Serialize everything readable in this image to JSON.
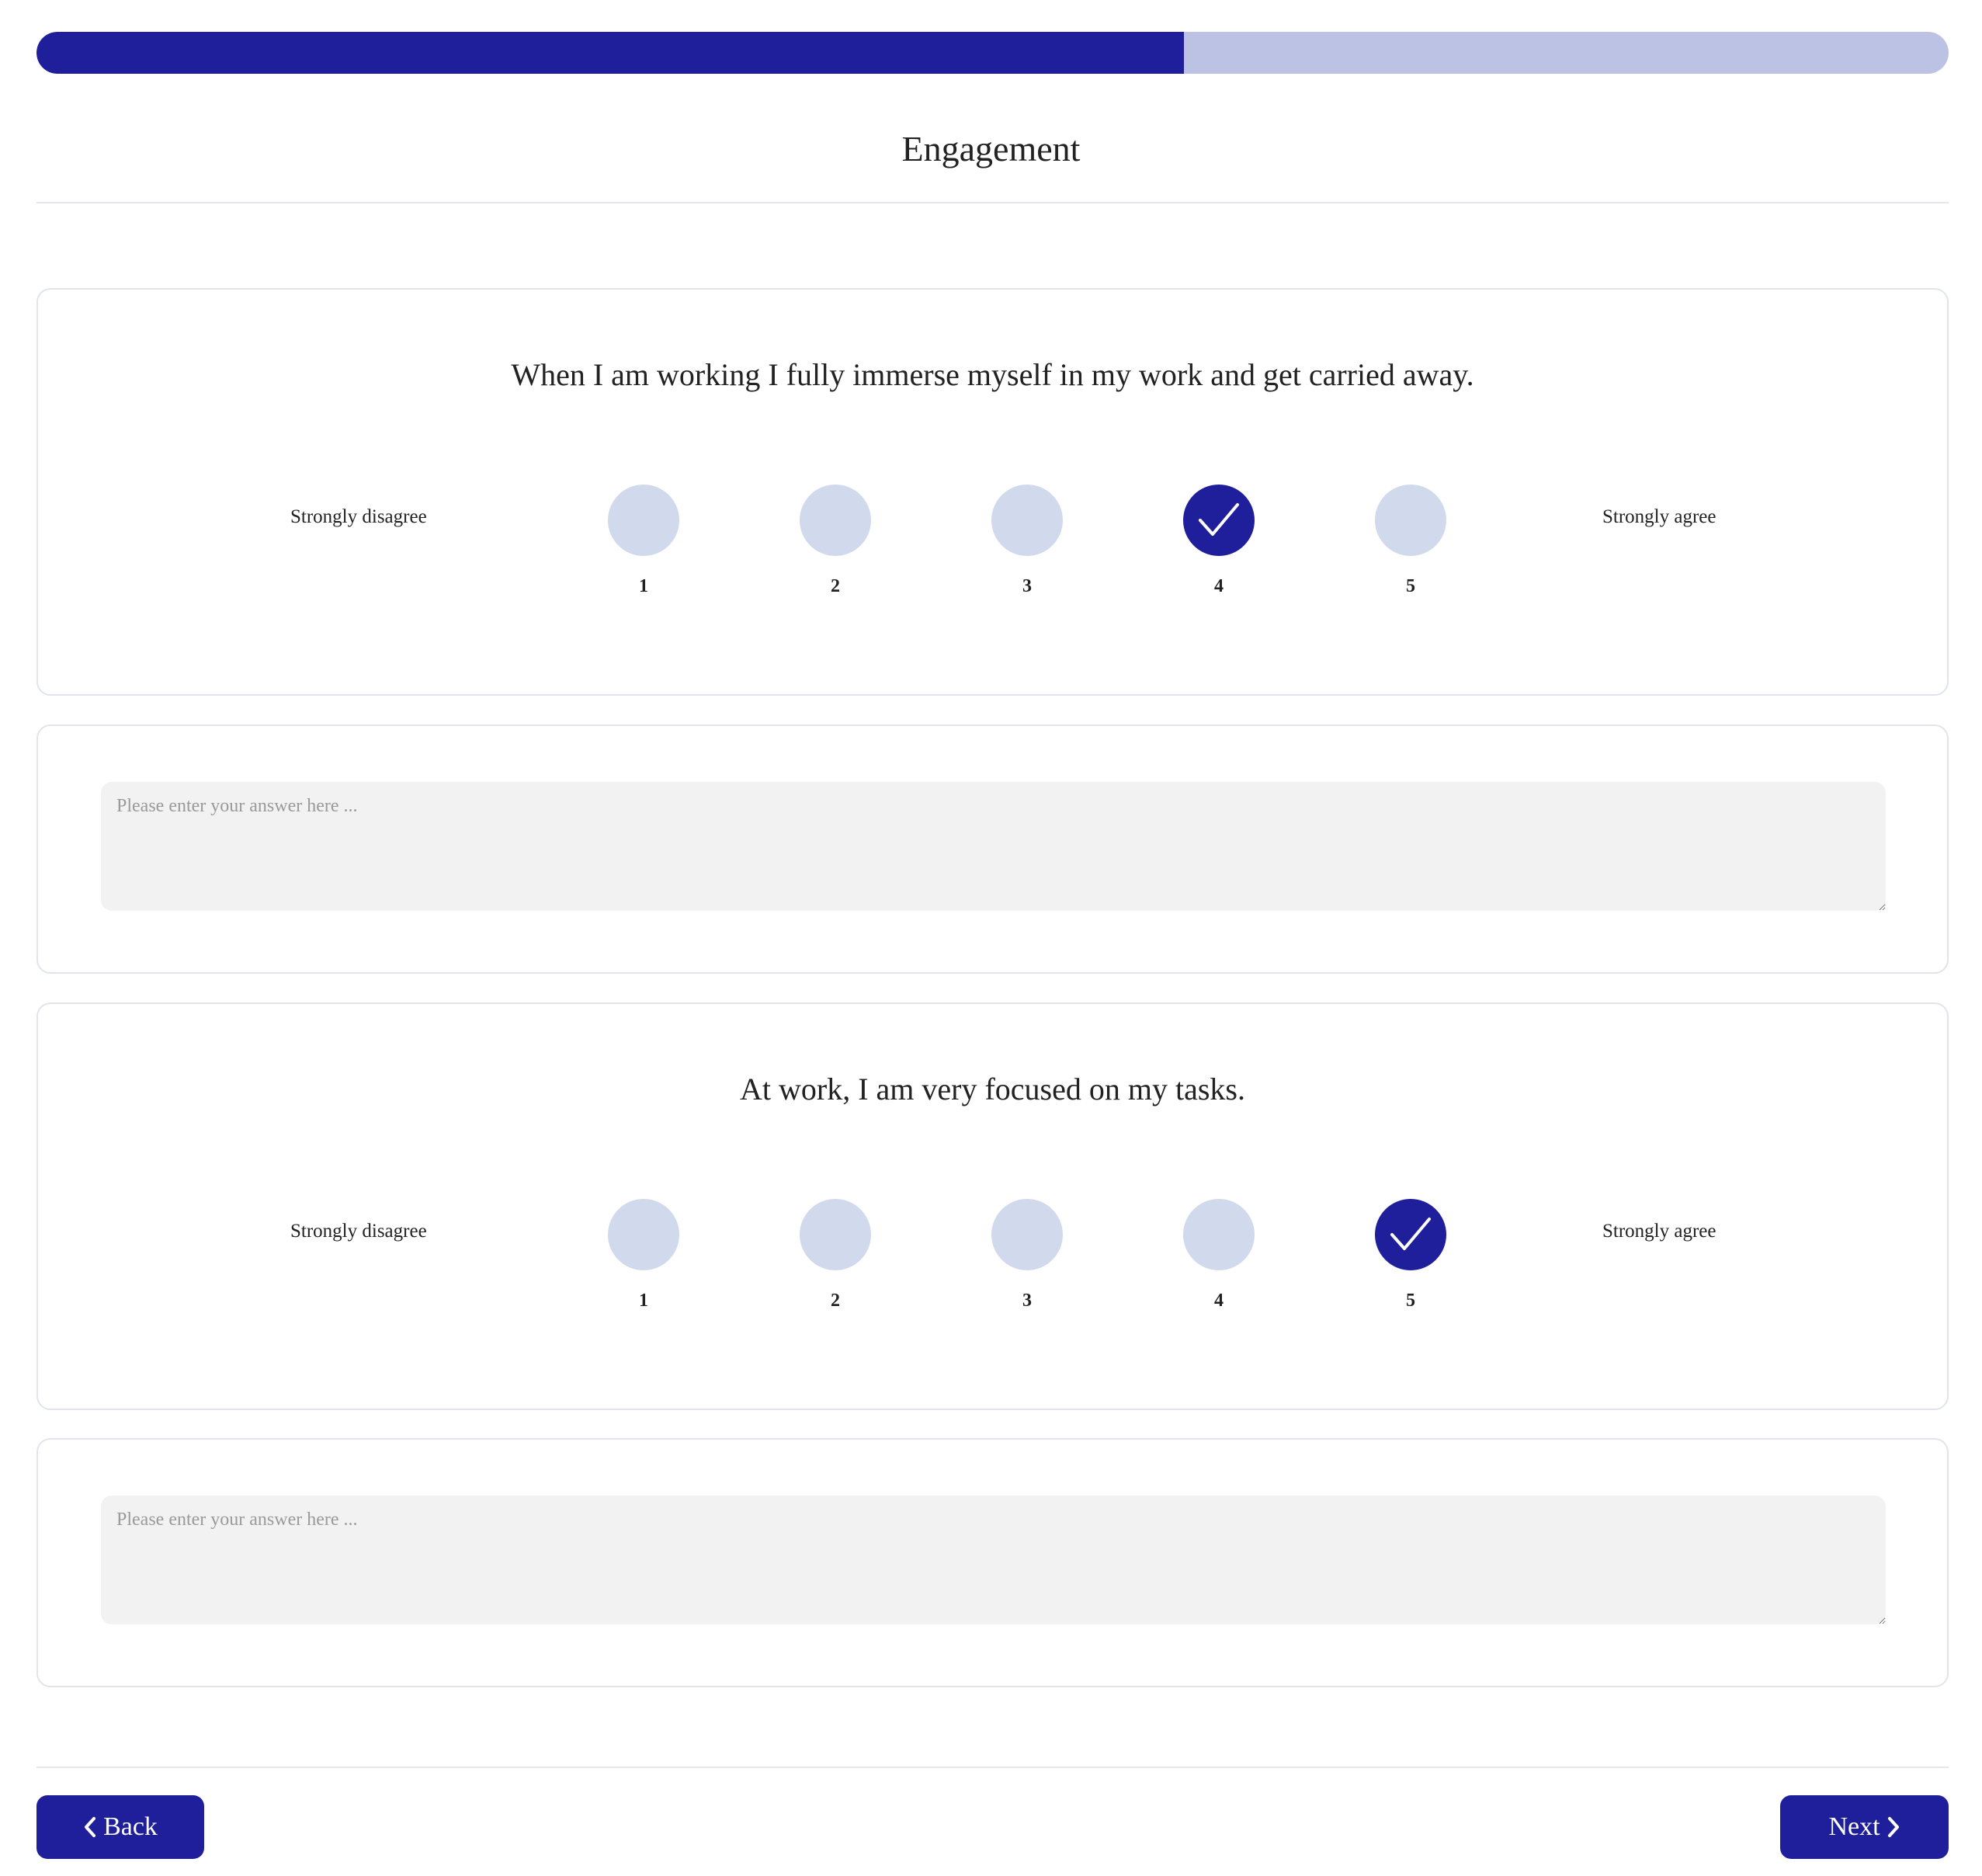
{
  "progress": {
    "fraction": 0.6,
    "color_fill": "#1f1f9c",
    "color_track": "#bcc2e3"
  },
  "page": {
    "title": "Engagement"
  },
  "questions": [
    {
      "text": "When I am working I fully immerse myself in my work and get carried away.",
      "scale_min_label": "Strongly disagree",
      "scale_max_label": "Strongly agree",
      "options": [
        "1",
        "2",
        "3",
        "4",
        "5"
      ],
      "selected": "4",
      "answer_placeholder": "Please enter your answer here ...",
      "answer_value": ""
    },
    {
      "text": "At work, I am very focused on my tasks.",
      "scale_min_label": "Strongly disagree",
      "scale_max_label": "Strongly agree",
      "options": [
        "1",
        "2",
        "3",
        "4",
        "5"
      ],
      "selected": "5",
      "answer_placeholder": "Please enter your answer here ...",
      "answer_value": ""
    }
  ],
  "nav": {
    "back_label": "Back",
    "next_label": "Next"
  },
  "icons": {
    "selected_mark": "checkmark-icon",
    "back": "chevron-left-icon",
    "next": "chevron-right-icon"
  },
  "colors": {
    "accent": "#1f1f9c",
    "option_unselected": "#d1d9ec",
    "input_bg": "#f2f2f2"
  }
}
